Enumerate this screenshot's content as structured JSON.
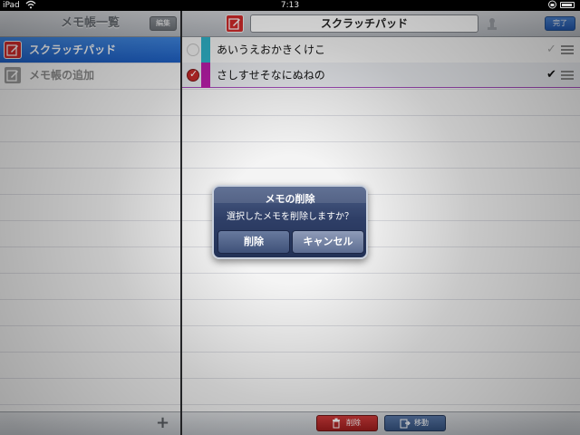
{
  "status_bar": {
    "carrier": "iPad",
    "time": "7:13"
  },
  "sidebar": {
    "title": "メモ帳一覧",
    "edit_label": "編集",
    "items": [
      {
        "label": "スクラッチパッド",
        "selected": true,
        "icon": "notepad-pencil-icon"
      },
      {
        "label": "メモ帳の追加",
        "selected": false,
        "icon": "notepad-add-icon"
      }
    ],
    "add_icon": "+"
  },
  "main": {
    "title": "スクラッチパッド",
    "done_label": "完了",
    "notes": [
      {
        "text": "あいうえおかきくけこ",
        "color": "#2fb3c9",
        "selected": false,
        "checked": false
      },
      {
        "text": "さしすせそなにぬねの",
        "color": "#b81da8",
        "selected": true,
        "checked": true
      }
    ],
    "check_glyph": "✔",
    "radio_glyph": "✓",
    "toolbar": {
      "delete_label": "削除",
      "move_label": "移動"
    }
  },
  "alert": {
    "title": "メモの削除",
    "message": "選択したメモを削除しますか？",
    "delete_label": "削除",
    "cancel_label": "キャンセル"
  }
}
